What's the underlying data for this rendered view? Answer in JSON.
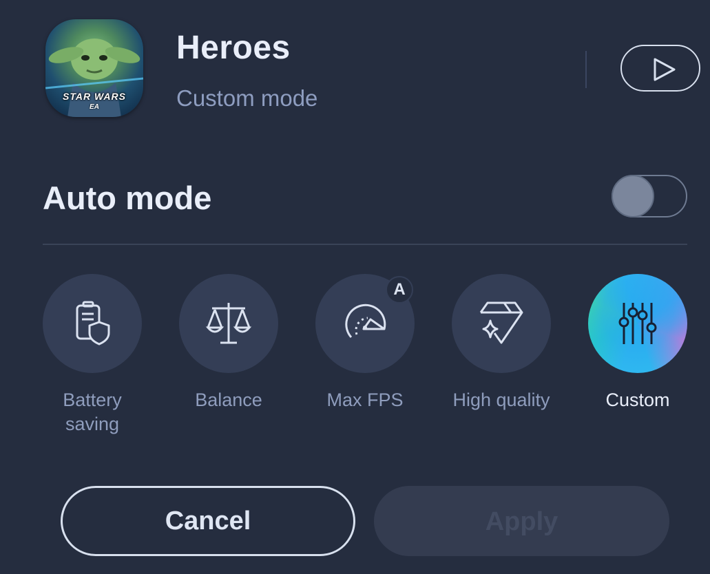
{
  "app": {
    "title": "Heroes",
    "subtitle": "Custom mode",
    "logo_text": "STAR WARS",
    "logo_sub": "EA"
  },
  "auto_mode": {
    "label": "Auto mode",
    "enabled": false
  },
  "modes": [
    {
      "label": "Battery saving",
      "icon": "battery-shield-icon",
      "active": false
    },
    {
      "label": "Balance",
      "icon": "scale-icon",
      "active": false
    },
    {
      "label": "Max FPS",
      "icon": "speedometer-icon",
      "active": false,
      "badge": "A"
    },
    {
      "label": "High quality",
      "icon": "diamond-sparkle-icon",
      "active": false
    },
    {
      "label": "Custom",
      "icon": "sliders-icon",
      "active": true
    }
  ],
  "buttons": {
    "cancel": "Cancel",
    "apply": "Apply"
  },
  "colors": {
    "background": "#252d3f",
    "circle": "#343e56",
    "accent": "#2fb7f0"
  }
}
